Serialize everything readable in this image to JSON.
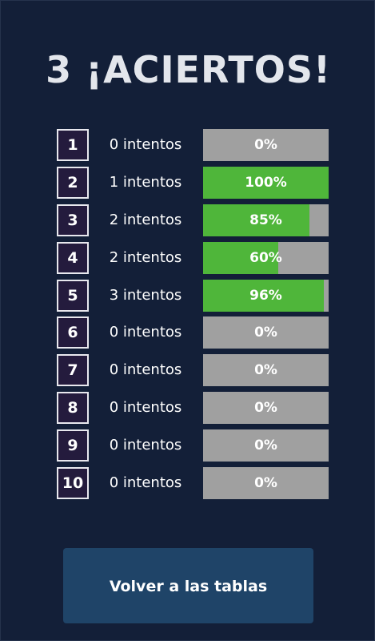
{
  "header": {
    "title": "3 ¡Aciertos!"
  },
  "results": [
    {
      "number": "1",
      "attempts": "0 intentos",
      "percent_label": "0%",
      "percent": 0
    },
    {
      "number": "2",
      "attempts": "1 intentos",
      "percent_label": "100%",
      "percent": 100
    },
    {
      "number": "3",
      "attempts": "2 intentos",
      "percent_label": "85%",
      "percent": 85
    },
    {
      "number": "4",
      "attempts": "2 intentos",
      "percent_label": "60%",
      "percent": 60
    },
    {
      "number": "5",
      "attempts": "3 intentos",
      "percent_label": "96%",
      "percent": 96
    },
    {
      "number": "6",
      "attempts": "0 intentos",
      "percent_label": "0%",
      "percent": 0
    },
    {
      "number": "7",
      "attempts": "0 intentos",
      "percent_label": "0%",
      "percent": 0
    },
    {
      "number": "8",
      "attempts": "0 intentos",
      "percent_label": "0%",
      "percent": 0
    },
    {
      "number": "9",
      "attempts": "0 intentos",
      "percent_label": "0%",
      "percent": 0
    },
    {
      "number": "10",
      "attempts": "0 intentos",
      "percent_label": "0%",
      "percent": 0
    }
  ],
  "footer": {
    "back_label": "Volver a las tablas"
  },
  "colors": {
    "background": "#131f38",
    "bar_track": "#a0a0a0",
    "bar_fill": "#4fb63a",
    "button": "#1f4468"
  }
}
